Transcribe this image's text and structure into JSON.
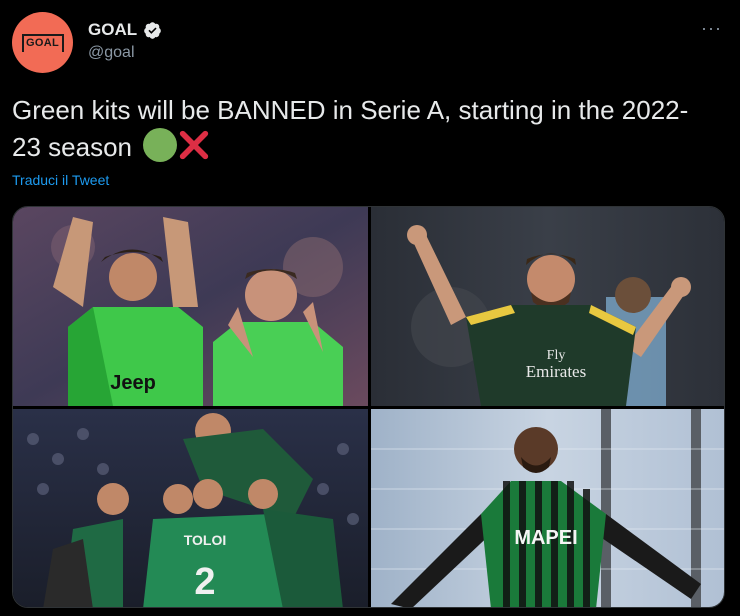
{
  "account": {
    "display_name": "GOAL",
    "handle": "@goal",
    "avatar_text": "GOAL",
    "verified": true
  },
  "tweet": {
    "text": "Green kits will be BANNED in Serie A, starting in the 2022-23 season",
    "emojis": [
      "green-circle",
      "cross-mark"
    ],
    "translate_label": "Traduci il Tweet"
  },
  "photos": [
    {
      "kit_text": "Jeep"
    },
    {
      "kit_text_1": "Fly",
      "kit_text_2": "Emirates"
    },
    {
      "kit_name": "TOLOI",
      "kit_number": "2"
    },
    {
      "kit_text": "MAPEI"
    }
  ],
  "colors": {
    "background": "#000000",
    "text": "#e7e9ea",
    "secondary_text": "#8b98a5",
    "link": "#1d9bf0",
    "avatar": "#f26b55"
  }
}
